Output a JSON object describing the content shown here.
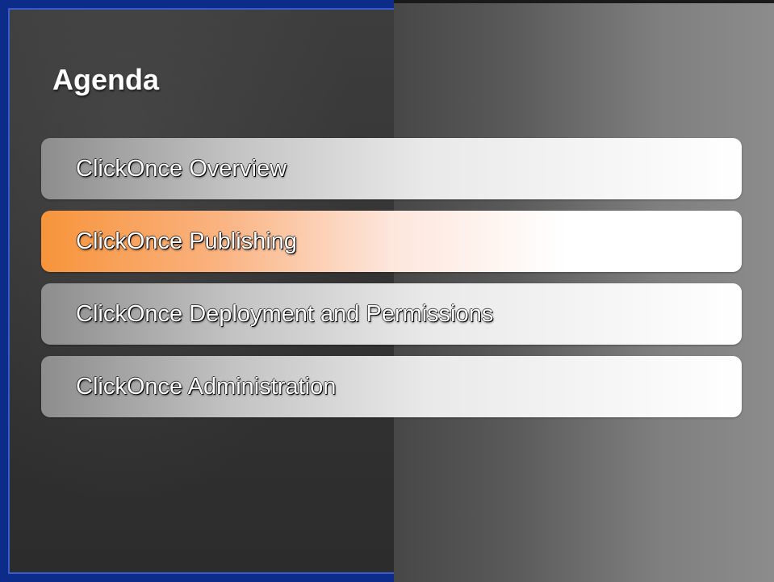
{
  "slide": {
    "title": "Agenda",
    "items": [
      {
        "label": "ClickOnce Overview",
        "active": false
      },
      {
        "label": "ClickOnce Publishing",
        "active": true
      },
      {
        "label": "ClickOnce Deployment and Permissions",
        "active": false
      },
      {
        "label": "ClickOnce Administration",
        "active": false
      }
    ]
  },
  "colors": {
    "frame_blue": "#0d2c8a",
    "highlight_orange": "#f7943b",
    "panel_dark": "#353535",
    "text_white": "#ffffff"
  }
}
